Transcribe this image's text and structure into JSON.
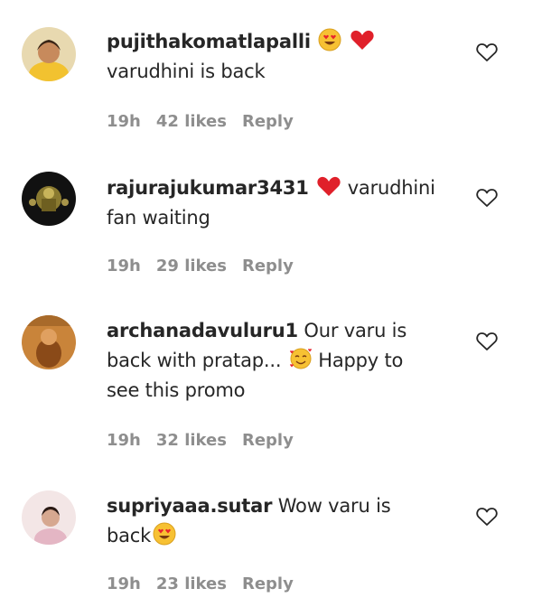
{
  "comments": [
    {
      "username": "pujithakomatlapalli",
      "text_line1": "",
      "text_line2": "varudhini is back",
      "time": "19h",
      "likes": "42 likes",
      "reply": "Reply",
      "emojis": [
        "heart-eyes-emoji",
        "red-heart-emoji"
      ]
    },
    {
      "username": "rajurajukumar3431",
      "text_line1": "varudhini",
      "text_line2": "fan waiting",
      "time": "19h",
      "likes": "29 likes",
      "reply": "Reply",
      "emojis": [
        "red-heart-emoji"
      ]
    },
    {
      "username": "archanadavuluru1",
      "text_line1": "Our varu is",
      "text_line2": "back with pratap...",
      "text_line2b": "Happy to",
      "text_line3": "see this promo",
      "time": "19h",
      "likes": "32 likes",
      "reply": "Reply",
      "emojis": [
        "smiling-face-with-hearts-emoji"
      ]
    },
    {
      "username": "supriyaaa.sutar",
      "text_line1": "Wow varu is",
      "text_line2": "back",
      "time": "19h",
      "likes": "23 likes",
      "reply": "Reply",
      "emojis": [
        "heart-eyes-emoji"
      ]
    }
  ]
}
